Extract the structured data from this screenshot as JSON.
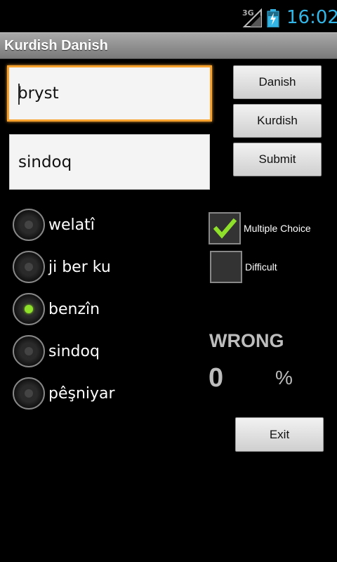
{
  "status_bar": {
    "network": "3G",
    "clock": "16:02",
    "colors": {
      "clock": "#33b5e5"
    }
  },
  "app": {
    "title": "Kurdish Danish"
  },
  "inputs": {
    "word": "bryst",
    "answer": "sindoq"
  },
  "buttons": {
    "danish": "Danish",
    "kurdish": "Kurdish",
    "submit": "Submit",
    "exit": "Exit"
  },
  "choices": [
    {
      "label": "welatî",
      "selected": false
    },
    {
      "label": "ji ber ku",
      "selected": false
    },
    {
      "label": "benzîn",
      "selected": true
    },
    {
      "label": "sindoq",
      "selected": false
    },
    {
      "label": "pêşniyar",
      "selected": false
    }
  ],
  "options": {
    "multiple_choice": {
      "label": "Multiple Choice",
      "checked": true
    },
    "difficult": {
      "label": "Difficult",
      "checked": false
    }
  },
  "result": {
    "label": "WRONG",
    "score": "0",
    "unit": "%"
  },
  "colors": {
    "focus": "#f7a12f",
    "radio_selected": "#8ee02a",
    "check_mark": "#8ee02a"
  }
}
